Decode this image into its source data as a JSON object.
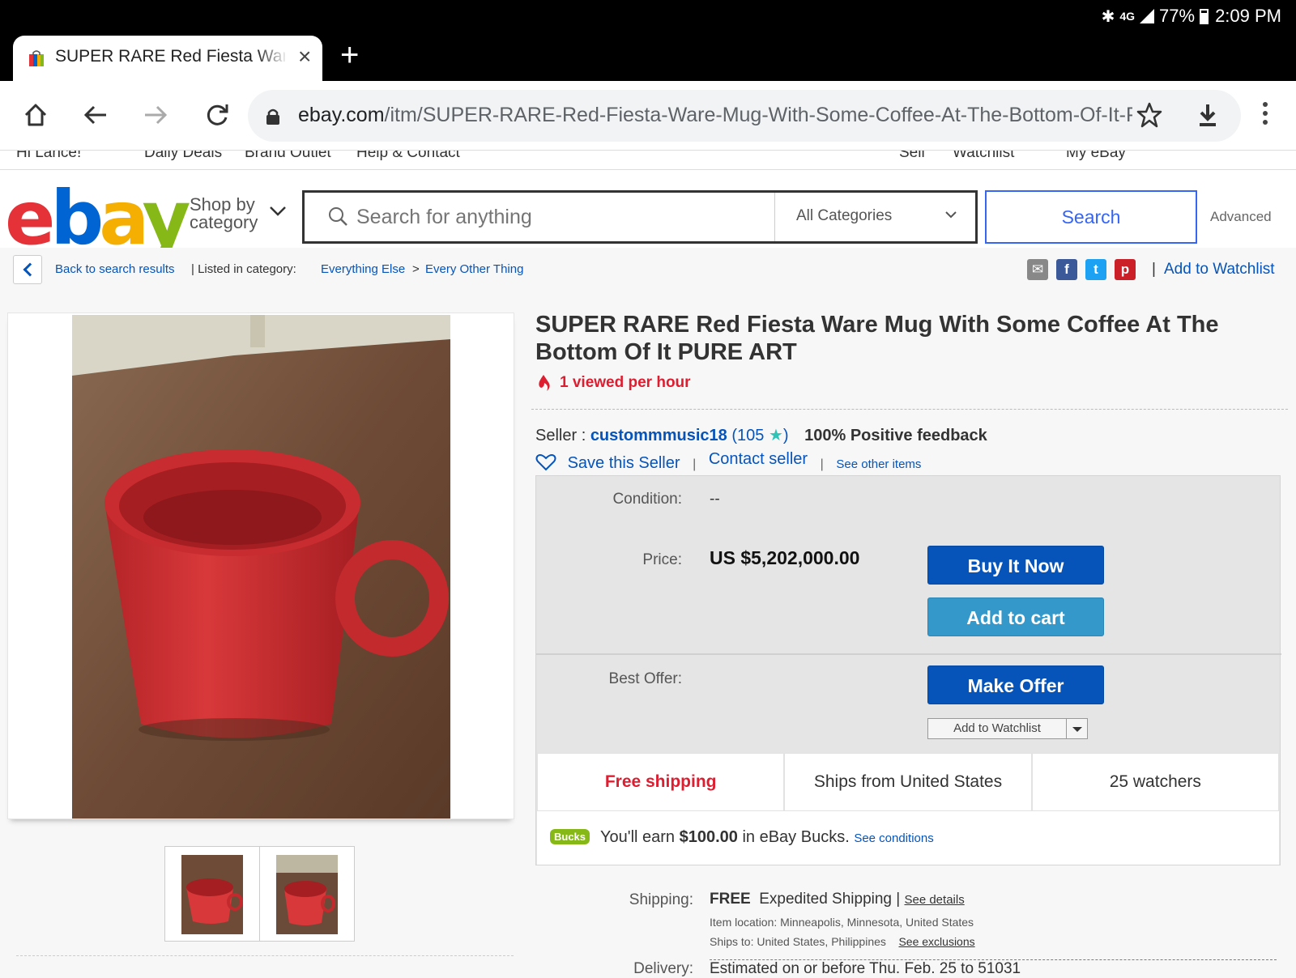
{
  "status": {
    "network": "4G",
    "battery": "77%",
    "time": "2:09 PM"
  },
  "tab": {
    "title": "SUPER RARE Red Fiesta Ware Mug With Some Coffee At The Bottom Of It PURE ART",
    "close": "×",
    "new_tab": "+"
  },
  "omnibox": {
    "domain": "ebay.com",
    "path": "/itm/SUPER-RARE-Red-Fiesta-Ware-Mug-With-Some-Coffee-At-The-Bottom-Of-It-PU"
  },
  "topnav": {
    "greeting": "Hi Lance!",
    "daily_deals": "Daily Deals",
    "brand_outlet": "Brand Outlet",
    "help": "Help & Contact",
    "sell": "Sell",
    "watchlist": "Watchlist",
    "myebay": "My eBay"
  },
  "header": {
    "shop_by_line1": "Shop by",
    "shop_by_line2": "category",
    "search_placeholder": "Search for anything",
    "category_select": "All Categories",
    "search_button": "Search",
    "advanced": "Advanced"
  },
  "breadcrumb": {
    "back": "Back to search results",
    "listed_in": "| Listed in category:",
    "cat1": "Everything Else",
    "arrow": ">",
    "cat2": "Every Other Thing",
    "add_to_watchlist": "Add to Watchlist",
    "sep": "|"
  },
  "item": {
    "title": "SUPER RARE Red Fiesta Ware Mug With Some Coffee At The Bottom Of It PURE ART",
    "viewed": "1 viewed per hour"
  },
  "seller": {
    "label": "Seller :",
    "name": "custommmusic18",
    "score_open": "(",
    "score": "105",
    "score_close": ")",
    "feedback": "100% Positive feedback",
    "save": "Save this Seller",
    "contact": "Contact seller",
    "other": "See other items",
    "sep": "|"
  },
  "buybox": {
    "condition_label": "Condition:",
    "condition_value": "--",
    "price_label": "Price:",
    "price": "US $5,202,000.00",
    "buy_now": "Buy It Now",
    "add_cart": "Add to cart",
    "best_offer_label": "Best Offer:",
    "make_offer": "Make Offer",
    "add_watchlist": "Add to Watchlist"
  },
  "strip": {
    "shipping": "Free shipping",
    "ships_from": "Ships from United States",
    "watchers": "25 watchers"
  },
  "bucks": {
    "logo": "Bucks",
    "earn_prefix": "You'll earn ",
    "amount": "$100.00",
    "earn_suffix": " in eBay Bucks.",
    "conditions": "See conditions"
  },
  "shipping": {
    "label": "Shipping:",
    "free": "FREE",
    "method": "Expedited Shipping |",
    "details": "See details",
    "location": "Item location:  Minneapolis, Minnesota, United States",
    "ships_to": "Ships to:  United States, Philippines",
    "exclusions": "See exclusions"
  },
  "delivery": {
    "label": "Delivery:",
    "text": "Estimated on or before Thu. Feb. 25 to 51031"
  },
  "colors": {
    "ebay_red": "#e53238",
    "ebay_blue": "#0064d2",
    "ebay_yellow": "#f5af02",
    "ebay_green": "#86b817",
    "link": "#0654ba",
    "primary_btn": "#0654ba",
    "secondary_btn": "#3498ca"
  },
  "icons": [
    "home-icon",
    "back-arrow-icon",
    "forward-arrow-icon",
    "reload-icon",
    "lock-icon",
    "star-icon",
    "download-icon",
    "menu-dots-icon",
    "search-icon",
    "chevron-down-icon",
    "mail-icon",
    "facebook-icon",
    "twitter-icon",
    "pinterest-icon",
    "heart-icon",
    "fire-icon"
  ]
}
